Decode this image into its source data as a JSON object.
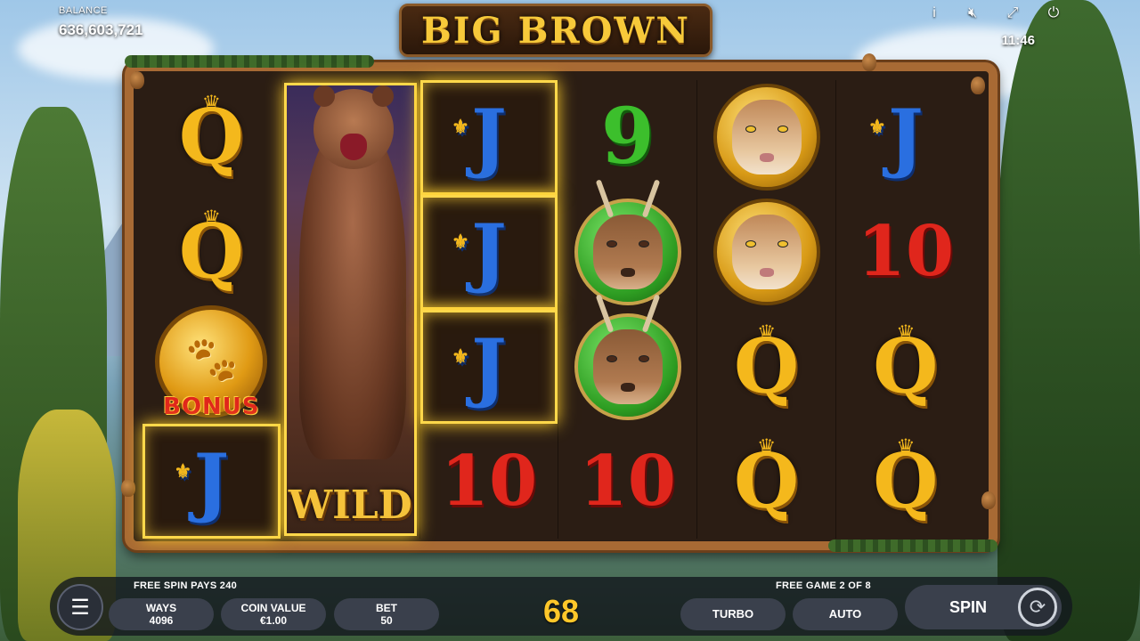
{
  "game": {
    "title": "BIG BROWN"
  },
  "hud": {
    "balance_label": "BALANCE",
    "balance_value": "636,603,721",
    "clock": "11:46",
    "icons": [
      "info-icon",
      "mute-icon",
      "fullscreen-icon",
      "power-icon"
    ]
  },
  "reels": [
    [
      "Q",
      "Q",
      "BONUS",
      "J"
    ],
    [
      "WILD"
    ],
    [
      "J",
      "J",
      "J",
      "10"
    ],
    [
      "9",
      "DEER",
      "DEER",
      "10"
    ],
    [
      "COUGAR",
      "COUGAR",
      "Q",
      "Q"
    ],
    [
      "J",
      "10",
      "Q",
      "Q"
    ]
  ],
  "symbols": {
    "bonus_label": "BONUS",
    "wild_label": "WILD"
  },
  "bottom": {
    "free_spin_pays": "FREE SPIN PAYS 240",
    "free_game": "FREE GAME 2 OF 8",
    "ways_label": "WAYS",
    "ways_value": "4096",
    "coin_label": "COIN VALUE",
    "coin_value": "€1.00",
    "bet_label": "BET",
    "bet_value": "50",
    "win_amount": "68",
    "turbo": "TURBO",
    "auto": "AUTO",
    "spin": "SPIN"
  },
  "colors": {
    "accent_gold": "#ffd84a",
    "win_text": "#ffc72a",
    "frame_wood": "#a86a34"
  }
}
